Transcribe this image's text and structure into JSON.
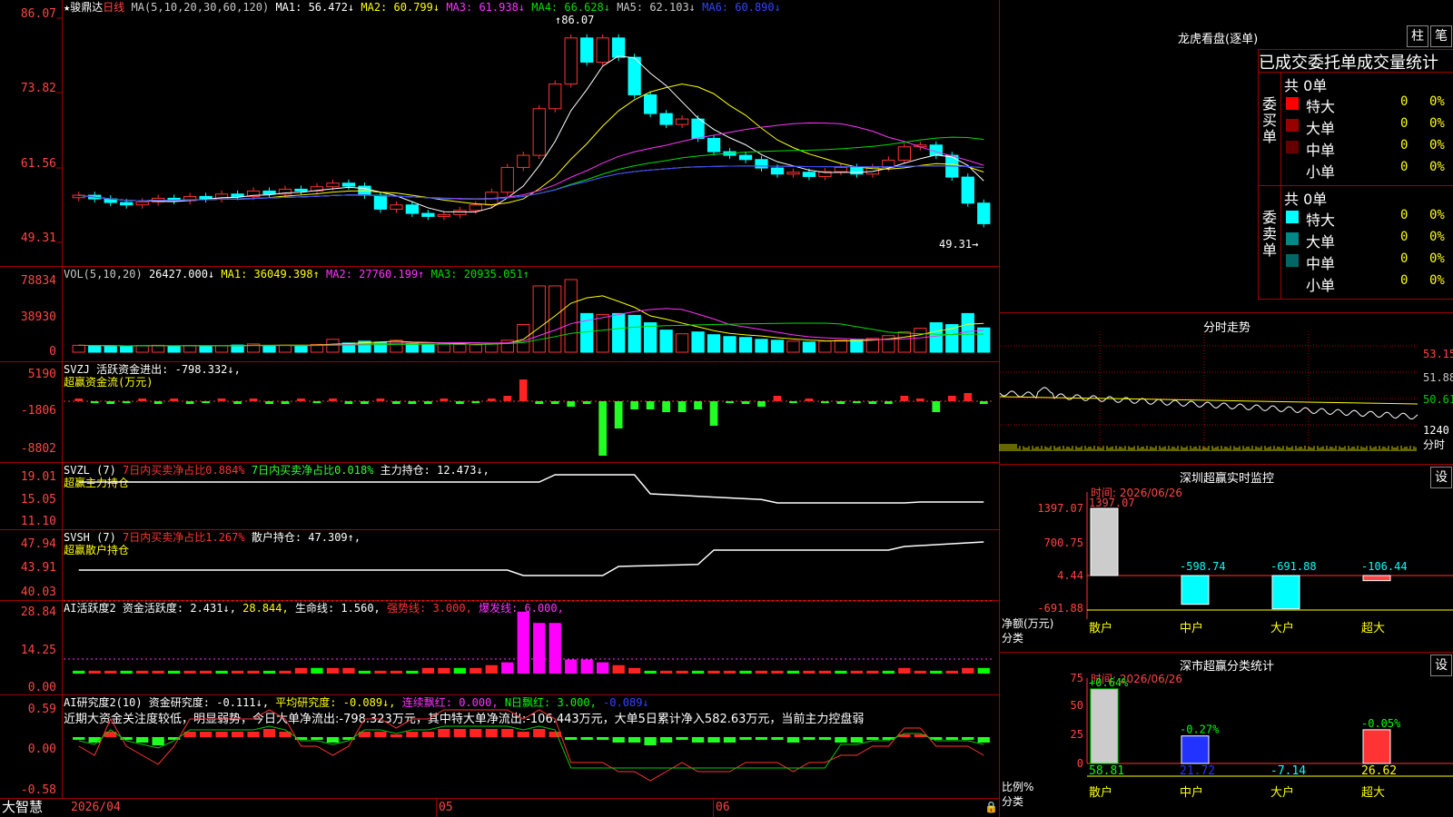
{
  "k_title": {
    "icon": "★",
    "stock": "骏鼎达",
    "period": "日线",
    "ma_label": "MA(5,10,20,30,60,120)",
    "ma": [
      {
        "name": "MA1",
        "value": "56.472↓",
        "color": "#ffffff"
      },
      {
        "name": "MA2",
        "value": "60.799↓",
        "color": "#ffff00"
      },
      {
        "name": "MA3",
        "value": "61.938↓",
        "color": "#ff33ff"
      },
      {
        "name": "MA4",
        "value": "66.628↓",
        "color": "#00dd00"
      },
      {
        "name": "MA5",
        "value": "62.103↓",
        "color": "#c8c8c8"
      },
      {
        "name": "MA6",
        "value": "60.890↓",
        "color": "#3344ff"
      }
    ]
  },
  "k_axis": [
    "86.07",
    "73.82",
    "61.56",
    "49.31"
  ],
  "k_high_label": "86.07",
  "k_low_label": "49.31",
  "vol": {
    "title": "VOL(5,10,20)",
    "value": "26427.000↓",
    "ma": [
      {
        "name": "MA1",
        "value": "36049.398↑",
        "color": "#ffff00"
      },
      {
        "name": "MA2",
        "value": "27760.199↑",
        "color": "#ff33ff"
      },
      {
        "name": "MA3",
        "value": "20935.051↑",
        "color": "#00dd00"
      }
    ],
    "axis": [
      "78834",
      "38930",
      "0"
    ]
  },
  "svzj": {
    "title": "SVZJ",
    "sub": "活跃资金进出:",
    "value": "-798.332↓,",
    "caption": "超赢资金流(万元)",
    "axis": [
      "5190",
      "-1806",
      "-8802"
    ]
  },
  "svzl": {
    "title": "SVZL (7)",
    "t1": "7日内买卖净占比0.884%",
    "t2": "7日内买卖净占比0.018%",
    "t3": "主力持仓: 12.473↓,",
    "caption": "超赢主力持仓",
    "axis": [
      "19.01",
      "15.05",
      "11.10"
    ]
  },
  "svsh": {
    "title": "SVSH (7)",
    "t1": "7日内买卖净占比1.267%",
    "t2": "散户持仓: 47.309↑,",
    "caption": "超赢散户持仓",
    "axis": [
      "47.94",
      "43.91",
      "40.03"
    ]
  },
  "ai1": {
    "title": "AI活跃度2 资金活跃度: 2.431↓,",
    "v2": "28.844,",
    "v3": "生命线: 1.560,",
    "v4": "强势线: 3.000,",
    "v5": "爆发线: 6.000,",
    "axis": [
      "28.84",
      "14.25",
      "0.00"
    ]
  },
  "ai2": {
    "title": "AI研究度2(10) 资金研究度: -0.111↓,",
    "v2": "平均研究度: -0.089↓,",
    "v3": "连续飘红: 0.000,",
    "v4": "N日飘红: 3.000,",
    "v5": "-0.089↓",
    "note": "近期大资金关注度较低，明显弱势，今日大单净流出:-798.323万元，其中特大单净流出:-106.443万元，大单5日累计净入582.63万元，当前主力控盘弱",
    "axis": [
      "0.59",
      "0.00",
      "-0.58"
    ]
  },
  "bottom": {
    "brand": "大智慧",
    "date": "2026/04",
    "months": [
      "05",
      "06"
    ]
  },
  "lhb": {
    "title": "龙虎看盘(逐单)",
    "btn1": "柱",
    "btn2": "笔",
    "header": "已成交委托单成交量统计",
    "buy_label": "委买单",
    "sell_label": "委卖单",
    "buy_total": "共 0单",
    "sell_total": "共 0单",
    "buy_rows": [
      {
        "name": "特大",
        "count": "0",
        "pct": "0%",
        "color": "#ff0000"
      },
      {
        "name": "大单",
        "count": "0",
        "pct": "0%",
        "color": "#990000"
      },
      {
        "name": "中单",
        "count": "0",
        "pct": "0%",
        "color": "#660000"
      },
      {
        "name": "小单",
        "count": "0",
        "pct": "0%",
        "color": "#000000"
      }
    ],
    "sell_rows": [
      {
        "name": "特大",
        "count": "0",
        "pct": "0%",
        "color": "#00ffff"
      },
      {
        "name": "大单",
        "count": "0",
        "pct": "0%",
        "color": "#008888"
      },
      {
        "name": "中单",
        "count": "0",
        "pct": "0%",
        "color": "#006666"
      },
      {
        "name": "小单",
        "count": "0",
        "pct": "0%",
        "color": "#000000"
      }
    ]
  },
  "fs": {
    "title": "分时走势",
    "axis_r": [
      "53.15",
      "51.88",
      "50.61",
      "1240",
      "分时"
    ]
  },
  "sz_monitor": {
    "title": "深圳超赢实时监控",
    "btn": "设",
    "time": "时间: 2026/06/26",
    "axis": [
      "1397.07",
      "700.75",
      "4.44",
      "-691.88"
    ],
    "ylabel": "净额(万元)",
    "xlabel": "分类",
    "cats": [
      "散户",
      "中户",
      "大户",
      "超大"
    ],
    "values": [
      1397.07,
      -598.74,
      -691.88,
      -106.44
    ],
    "value_labels": [
      "1397.07",
      "-598.74",
      "-691.88",
      "-106.44"
    ]
  },
  "sz_class": {
    "title": "深市超赢分类统计",
    "btn": "设",
    "time": "时间: 2026/06/26",
    "axis": [
      "75",
      "50",
      "25",
      "0"
    ],
    "ylabel": "比例%",
    "xlabel": "分类",
    "cats": [
      "散户",
      "中户",
      "大户",
      "超大"
    ],
    "values": [
      58.81,
      21.72,
      -7.14,
      26.62
    ],
    "bottom_labels": [
      "58.81",
      "21.72",
      "-7.14",
      "26.62"
    ],
    "top_labels": [
      "+0.64%",
      "-0.27%",
      "",
      "-0.05%"
    ]
  },
  "chart_data": {
    "type": "candlestick",
    "title": "骏鼎达 日线",
    "ylim": [
      49.31,
      86.07
    ],
    "x": [
      "2026/04",
      "05",
      "06"
    ],
    "candles_close": [
      56.8,
      56.2,
      55.6,
      55.2,
      55.7,
      56.3,
      55.9,
      56.6,
      56.2,
      57.0,
      56.6,
      57.5,
      57.0,
      57.8,
      57.5,
      58.2,
      58.8,
      58.3,
      56.8,
      54.5,
      55.2,
      53.8,
      53.3,
      53.6,
      54.3,
      55.2,
      57.3,
      61.4,
      63.4,
      71.1,
      75.2,
      82.8,
      78.8,
      82.8,
      79.6,
      73.4,
      70.3,
      68.5,
      69.4,
      66.2,
      64.0,
      63.4,
      62.7,
      61.3,
      60.3,
      60.6,
      59.9,
      60.7,
      61.4,
      60.3,
      61.4,
      62.6,
      64.8,
      65.1,
      63.4,
      59.8,
      55.5,
      52.1
    ],
    "vol_values": [
      7500,
      7000,
      6800,
      6500,
      7000,
      7500,
      6800,
      7200,
      6500,
      7000,
      7800,
      9000,
      7000,
      7500,
      6800,
      8500,
      14000,
      10000,
      12000,
      11000,
      13000,
      9000,
      8000,
      9500,
      8500,
      8000,
      10000,
      13000,
      30000,
      72000,
      72000,
      78834,
      42000,
      41000,
      42000,
      40000,
      32000,
      24000,
      20000,
      22000,
      19000,
      17000,
      16000,
      14000,
      13000,
      12000,
      11000,
      12000,
      13000,
      14000,
      15000,
      18000,
      22000,
      26000,
      32000,
      30000,
      42000,
      26427
    ]
  }
}
